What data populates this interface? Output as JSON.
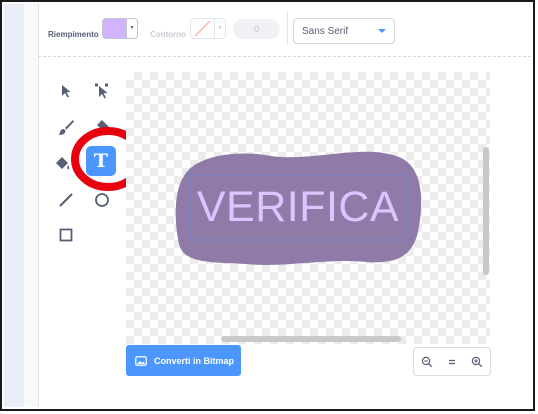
{
  "toolbar": {
    "fill_label": "Riempimento",
    "fill_color": "#d1b3ff",
    "outline_label": "Contorno",
    "outline_width": "0",
    "font_value": "Sans Serif"
  },
  "tools": [
    {
      "icon": "select-arrow-icon"
    },
    {
      "icon": "reshape-icon"
    },
    {
      "icon": "brush-icon"
    },
    {
      "icon": "eraser-icon"
    },
    {
      "icon": "fill-icon"
    },
    {
      "icon": "text-icon",
      "letter": "T",
      "active": true
    },
    {
      "icon": "line-icon"
    },
    {
      "icon": "circle-icon"
    },
    {
      "icon": "rectangle-icon"
    }
  ],
  "canvas": {
    "text": "VERIFICA",
    "blob_color": "#8f7aa8",
    "text_color": "#d9c5ff"
  },
  "highlight_color": "#e8000d",
  "bottom": {
    "convert_label": "Converti in Bitmap",
    "zoom_out_icon": "zoom-out-icon",
    "zoom_reset_icon": "zoom-reset-icon",
    "zoom_in_icon": "zoom-in-icon"
  }
}
